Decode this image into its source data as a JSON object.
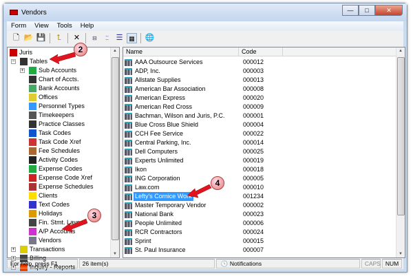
{
  "window": {
    "title": "Vendors",
    "min": "—",
    "max": "□",
    "close": "✕"
  },
  "menu": [
    "Form",
    "View",
    "Tools",
    "Help"
  ],
  "toolbar": [
    "new-icon",
    "open-icon",
    "save-icon",
    "up-folder-icon",
    "delete-icon",
    "large-icons-icon",
    "small-icons-icon",
    "list-icon",
    "details-icon",
    "web-icon"
  ],
  "tree": {
    "root": "Juris",
    "tables": "Tables",
    "items": [
      "Sub Accounts",
      "Chart of Accts.",
      "Bank Accounts",
      "Offices",
      "Personnel Types",
      "Timekeepers",
      "Practice Classes",
      "Task Codes",
      "Task Code Xref",
      "Fee Schedules",
      "Activity Codes",
      "Expense Codes",
      "Expense Code Xref",
      "Expense Schedules",
      "Clients",
      "Text Codes",
      "Holidays",
      "Fin. Stmt. Layout",
      "A/P Accounts",
      "Vendors"
    ],
    "after": [
      "Transactions",
      "Billing",
      "Inquiry - Reports"
    ]
  },
  "list": {
    "columns": [
      "Name",
      "Code"
    ],
    "rows": [
      [
        "AAA Outsource Services",
        "000012"
      ],
      [
        "ADP, Inc.",
        "000003"
      ],
      [
        "Allstate Supplies",
        "000013"
      ],
      [
        "American Bar Association",
        "000008"
      ],
      [
        "American Express",
        "000020"
      ],
      [
        "American Red Cross",
        "000009"
      ],
      [
        "Bachman, Wilson and Juris, P.C.",
        "000001"
      ],
      [
        "Blue Cross Blue Shield",
        "000004"
      ],
      [
        "CCH Fee Service",
        "000022"
      ],
      [
        "Central Parking, Inc.",
        "000014"
      ],
      [
        "Dell Computers",
        "000025"
      ],
      [
        "Experts Unlimited",
        "000019"
      ],
      [
        "Ikon",
        "000018"
      ],
      [
        "ING Corporation",
        "000005"
      ],
      [
        "Law.com",
        "000010"
      ],
      [
        "Lefty's Cornice Work",
        "001234"
      ],
      [
        "Master Temporary Vendor",
        "000002"
      ],
      [
        "National Bank",
        "000023"
      ],
      [
        "People Unlimited",
        "000006"
      ],
      [
        "RCR Contractors",
        "000024"
      ],
      [
        "Sprint",
        "000015"
      ],
      [
        "St. Paul Insurance",
        "000007"
      ]
    ],
    "selected": "Lefty's Cornice Work"
  },
  "status": {
    "help": "For help, press F1",
    "count": "26 item(s)",
    "notifications": "Notifications",
    "caps": "CAPS",
    "num": "NUM"
  },
  "callouts": [
    "2",
    "3",
    "4"
  ],
  "colors": {
    "selection": "#3399ff",
    "arrow": "#e0141e"
  }
}
